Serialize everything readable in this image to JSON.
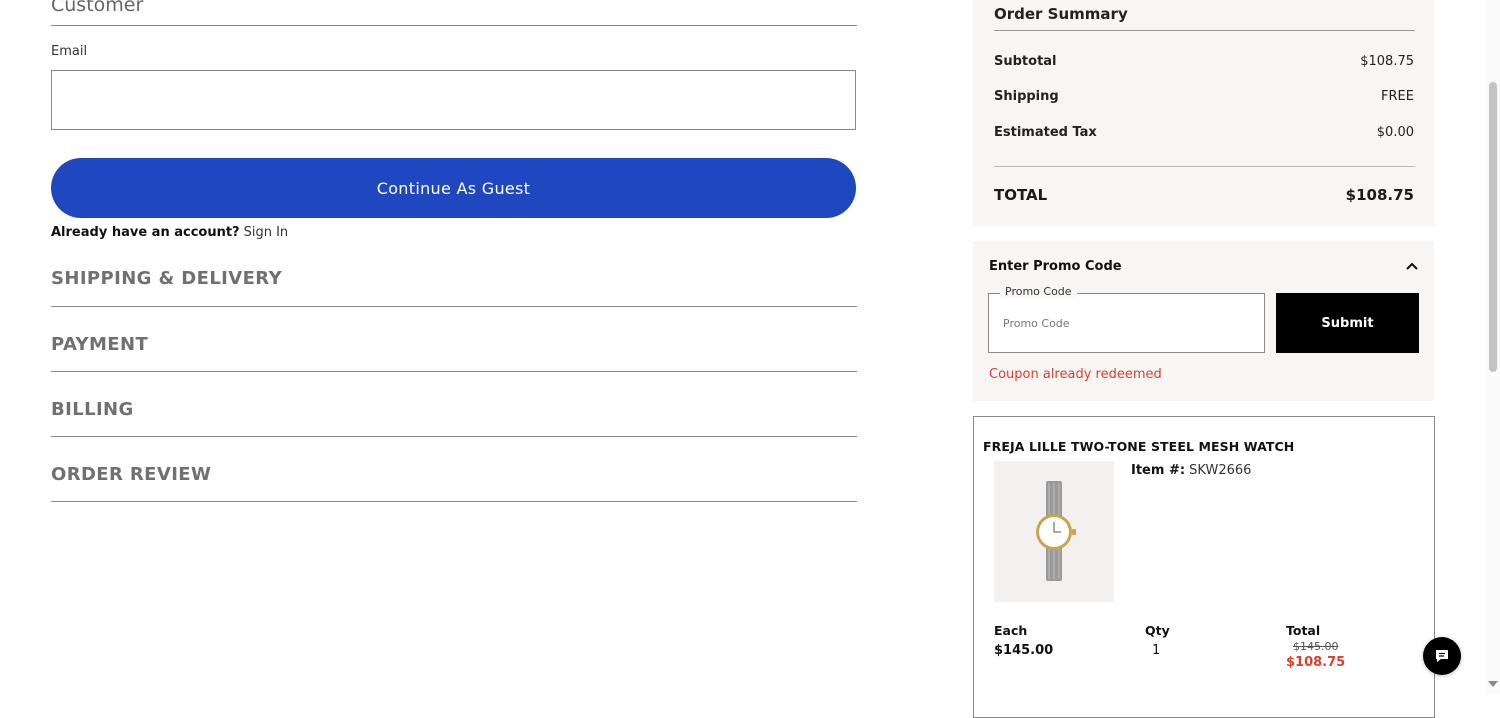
{
  "customer": {
    "title": "Customer",
    "email_label": "Email",
    "email_value": "",
    "guest_button": "Continue As Guest",
    "account_question": "Already have an account?",
    "sign_in": "Sign In"
  },
  "sections": [
    {
      "label": "SHIPPING & DELIVERY"
    },
    {
      "label": "PAYMENT"
    },
    {
      "label": "BILLING"
    },
    {
      "label": "ORDER REVIEW"
    }
  ],
  "summary": {
    "title": "Order Summary",
    "rows": [
      {
        "label": "Subtotal",
        "value": "$108.75"
      },
      {
        "label": "Shipping",
        "value": "FREE"
      },
      {
        "label": "Estimated Tax",
        "value": "$0.00"
      }
    ],
    "total_label": "TOTAL",
    "total_value": "$108.75"
  },
  "promo": {
    "title": "Enter Promo Code",
    "legend": "Promo Code",
    "placeholder": "Promo Code",
    "submit": "Submit",
    "error": "Coupon already redeemed",
    "error_color": "#d9402b"
  },
  "item": {
    "name": "FREJA LILLE TWO-TONE STEEL MESH WATCH",
    "item_num_label": "Item #:",
    "item_num": "SKW2666",
    "each_label": "Each",
    "each_value": "$145.00",
    "qty_label": "Qty",
    "qty_value": "1",
    "total_label": "Total",
    "total_original": "$145.00",
    "total_sale": "$108.75"
  },
  "icons": {
    "caret": "chevron-up-icon",
    "chat": "chat-icon"
  },
  "colors": {
    "primary_button": "#1e47c0",
    "sale": "#d9402b",
    "panel_bg": "#f8f6f4"
  }
}
